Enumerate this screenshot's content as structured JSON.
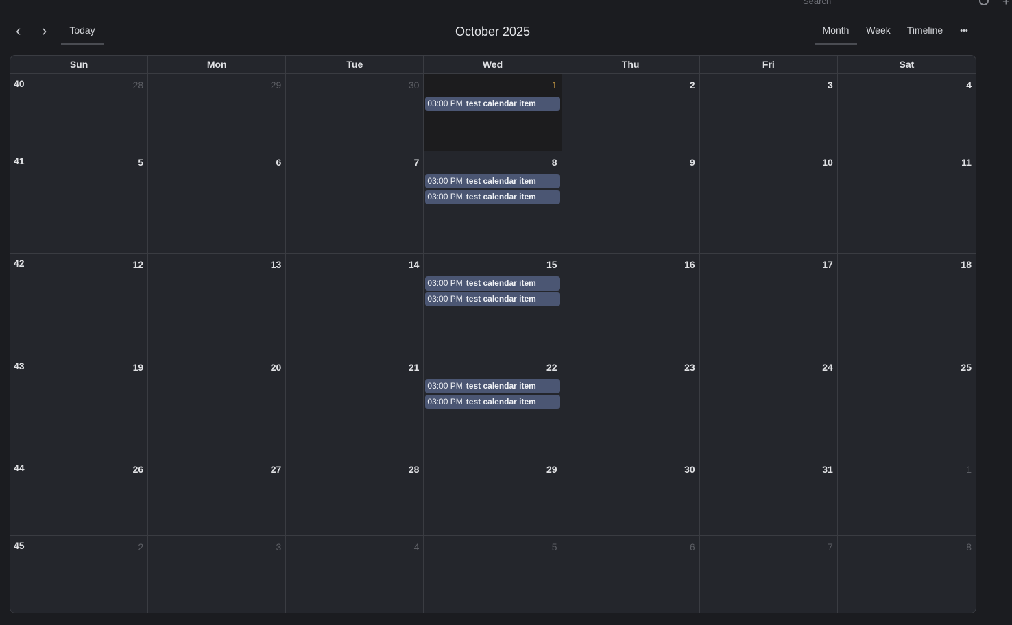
{
  "topbar": {
    "search_placeholder": "Search"
  },
  "toolbar": {
    "prev": "‹",
    "next": "›",
    "today_label": "Today",
    "title": "October 2025",
    "views": [
      "Month",
      "Week",
      "Timeline"
    ],
    "active_view": "Month",
    "more": "•••"
  },
  "weekdays": [
    "Sun",
    "Mon",
    "Tue",
    "Wed",
    "Thu",
    "Fri",
    "Sat"
  ],
  "weeks": [
    {
      "week": "40",
      "days": [
        {
          "d": "28",
          "muted": true
        },
        {
          "d": "29",
          "muted": true
        },
        {
          "d": "30",
          "muted": true
        },
        {
          "d": "1",
          "today": true,
          "events": [
            {
              "time": "03:00 PM",
              "name": "test calendar item"
            }
          ]
        },
        {
          "d": "2"
        },
        {
          "d": "3"
        },
        {
          "d": "4"
        }
      ]
    },
    {
      "week": "41",
      "days": [
        {
          "d": "5"
        },
        {
          "d": "6"
        },
        {
          "d": "7"
        },
        {
          "d": "8",
          "events": [
            {
              "time": "03:00 PM",
              "name": "test calendar item"
            },
            {
              "time": "03:00 PM",
              "name": "test calendar item"
            }
          ]
        },
        {
          "d": "9"
        },
        {
          "d": "10"
        },
        {
          "d": "11"
        }
      ]
    },
    {
      "week": "42",
      "days": [
        {
          "d": "12"
        },
        {
          "d": "13"
        },
        {
          "d": "14"
        },
        {
          "d": "15",
          "events": [
            {
              "time": "03:00 PM",
              "name": "test calendar item"
            },
            {
              "time": "03:00 PM",
              "name": "test calendar item"
            }
          ]
        },
        {
          "d": "16"
        },
        {
          "d": "17"
        },
        {
          "d": "18"
        }
      ]
    },
    {
      "week": "43",
      "days": [
        {
          "d": "19"
        },
        {
          "d": "20"
        },
        {
          "d": "21"
        },
        {
          "d": "22",
          "events": [
            {
              "time": "03:00 PM",
              "name": "test calendar item"
            },
            {
              "time": "03:00 PM",
              "name": "test calendar item"
            }
          ]
        },
        {
          "d": "23"
        },
        {
          "d": "24"
        },
        {
          "d": "25"
        }
      ]
    },
    {
      "week": "44",
      "days": [
        {
          "d": "26"
        },
        {
          "d": "27"
        },
        {
          "d": "28"
        },
        {
          "d": "29"
        },
        {
          "d": "30"
        },
        {
          "d": "31"
        },
        {
          "d": "1",
          "muted": true
        }
      ]
    },
    {
      "week": "45",
      "days": [
        {
          "d": "2",
          "muted": true
        },
        {
          "d": "3",
          "muted": true
        },
        {
          "d": "4",
          "muted": true
        },
        {
          "d": "5",
          "muted": true
        },
        {
          "d": "6",
          "muted": true
        },
        {
          "d": "7",
          "muted": true
        },
        {
          "d": "8",
          "muted": true
        }
      ]
    }
  ]
}
